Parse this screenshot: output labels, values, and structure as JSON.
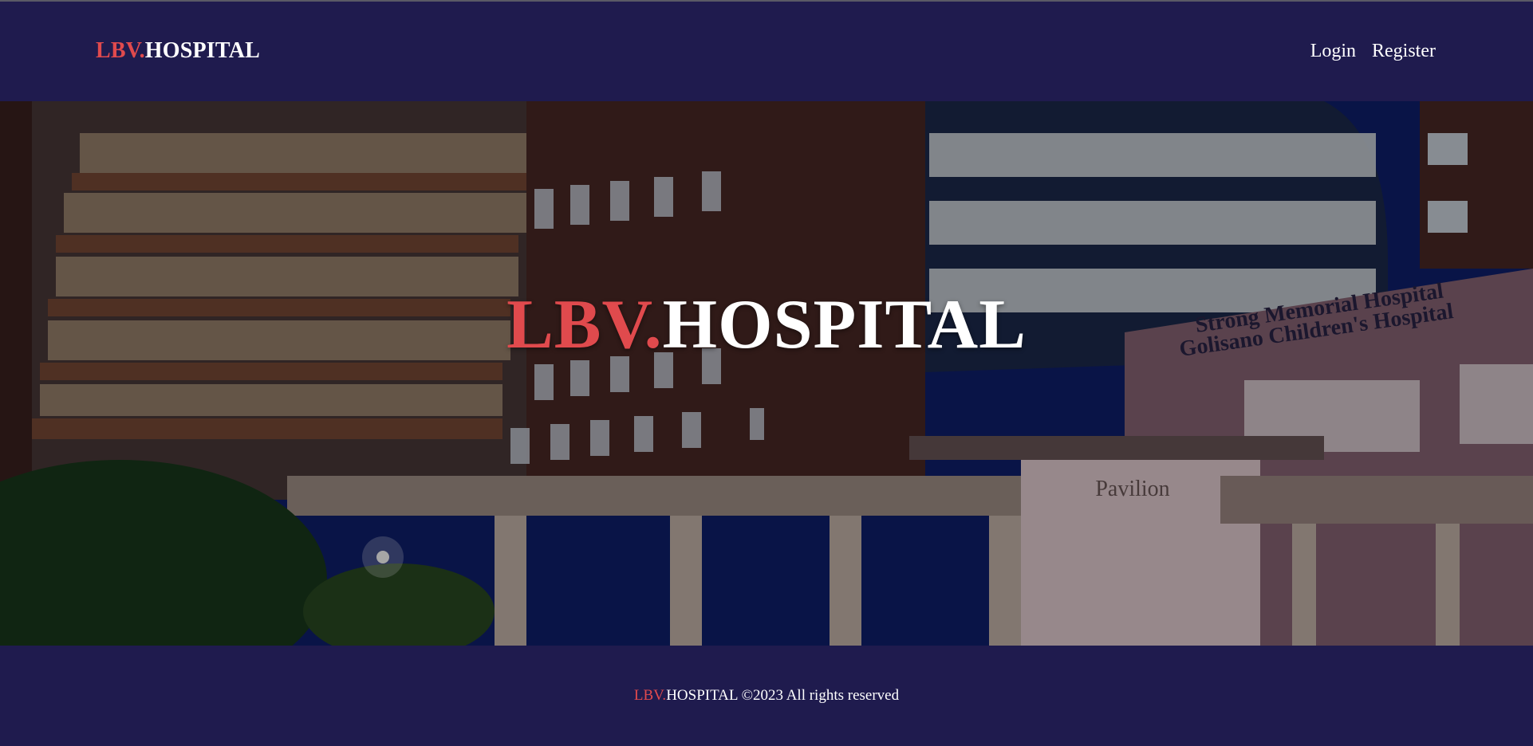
{
  "brand": {
    "accent": "LBV.",
    "name": "HOSPITAL"
  },
  "nav": {
    "login": "Login",
    "register": "Register"
  },
  "hero": {
    "title_accent": "LBV.",
    "title_name": "HOSPITAL",
    "building_sign_line1": "Strong Memorial Hospital",
    "building_sign_line2": "Golisano Children's Hospital",
    "pavilion_sign": "Pavilion"
  },
  "footer": {
    "accent": "LBV.",
    "name": "HOSPITAL",
    "copyright": " ©2023 All rights reserved"
  },
  "colors": {
    "background": "#1f1b4e",
    "accent": "#e04a4d",
    "text": "#ffffff"
  }
}
